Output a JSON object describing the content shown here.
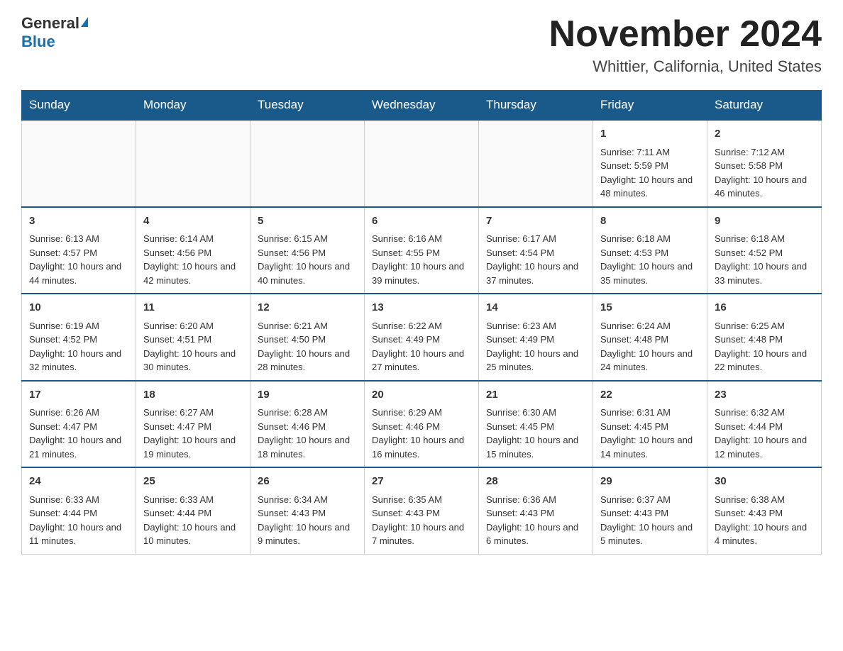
{
  "header": {
    "logo_general": "General",
    "logo_blue": "Blue",
    "title": "November 2024",
    "subtitle": "Whittier, California, United States"
  },
  "weekdays": [
    "Sunday",
    "Monday",
    "Tuesday",
    "Wednesday",
    "Thursday",
    "Friday",
    "Saturday"
  ],
  "weeks": [
    [
      {
        "day": "",
        "info": ""
      },
      {
        "day": "",
        "info": ""
      },
      {
        "day": "",
        "info": ""
      },
      {
        "day": "",
        "info": ""
      },
      {
        "day": "",
        "info": ""
      },
      {
        "day": "1",
        "info": "Sunrise: 7:11 AM\nSunset: 5:59 PM\nDaylight: 10 hours and 48 minutes."
      },
      {
        "day": "2",
        "info": "Sunrise: 7:12 AM\nSunset: 5:58 PM\nDaylight: 10 hours and 46 minutes."
      }
    ],
    [
      {
        "day": "3",
        "info": "Sunrise: 6:13 AM\nSunset: 4:57 PM\nDaylight: 10 hours and 44 minutes."
      },
      {
        "day": "4",
        "info": "Sunrise: 6:14 AM\nSunset: 4:56 PM\nDaylight: 10 hours and 42 minutes."
      },
      {
        "day": "5",
        "info": "Sunrise: 6:15 AM\nSunset: 4:56 PM\nDaylight: 10 hours and 40 minutes."
      },
      {
        "day": "6",
        "info": "Sunrise: 6:16 AM\nSunset: 4:55 PM\nDaylight: 10 hours and 39 minutes."
      },
      {
        "day": "7",
        "info": "Sunrise: 6:17 AM\nSunset: 4:54 PM\nDaylight: 10 hours and 37 minutes."
      },
      {
        "day": "8",
        "info": "Sunrise: 6:18 AM\nSunset: 4:53 PM\nDaylight: 10 hours and 35 minutes."
      },
      {
        "day": "9",
        "info": "Sunrise: 6:18 AM\nSunset: 4:52 PM\nDaylight: 10 hours and 33 minutes."
      }
    ],
    [
      {
        "day": "10",
        "info": "Sunrise: 6:19 AM\nSunset: 4:52 PM\nDaylight: 10 hours and 32 minutes."
      },
      {
        "day": "11",
        "info": "Sunrise: 6:20 AM\nSunset: 4:51 PM\nDaylight: 10 hours and 30 minutes."
      },
      {
        "day": "12",
        "info": "Sunrise: 6:21 AM\nSunset: 4:50 PM\nDaylight: 10 hours and 28 minutes."
      },
      {
        "day": "13",
        "info": "Sunrise: 6:22 AM\nSunset: 4:49 PM\nDaylight: 10 hours and 27 minutes."
      },
      {
        "day": "14",
        "info": "Sunrise: 6:23 AM\nSunset: 4:49 PM\nDaylight: 10 hours and 25 minutes."
      },
      {
        "day": "15",
        "info": "Sunrise: 6:24 AM\nSunset: 4:48 PM\nDaylight: 10 hours and 24 minutes."
      },
      {
        "day": "16",
        "info": "Sunrise: 6:25 AM\nSunset: 4:48 PM\nDaylight: 10 hours and 22 minutes."
      }
    ],
    [
      {
        "day": "17",
        "info": "Sunrise: 6:26 AM\nSunset: 4:47 PM\nDaylight: 10 hours and 21 minutes."
      },
      {
        "day": "18",
        "info": "Sunrise: 6:27 AM\nSunset: 4:47 PM\nDaylight: 10 hours and 19 minutes."
      },
      {
        "day": "19",
        "info": "Sunrise: 6:28 AM\nSunset: 4:46 PM\nDaylight: 10 hours and 18 minutes."
      },
      {
        "day": "20",
        "info": "Sunrise: 6:29 AM\nSunset: 4:46 PM\nDaylight: 10 hours and 16 minutes."
      },
      {
        "day": "21",
        "info": "Sunrise: 6:30 AM\nSunset: 4:45 PM\nDaylight: 10 hours and 15 minutes."
      },
      {
        "day": "22",
        "info": "Sunrise: 6:31 AM\nSunset: 4:45 PM\nDaylight: 10 hours and 14 minutes."
      },
      {
        "day": "23",
        "info": "Sunrise: 6:32 AM\nSunset: 4:44 PM\nDaylight: 10 hours and 12 minutes."
      }
    ],
    [
      {
        "day": "24",
        "info": "Sunrise: 6:33 AM\nSunset: 4:44 PM\nDaylight: 10 hours and 11 minutes."
      },
      {
        "day": "25",
        "info": "Sunrise: 6:33 AM\nSunset: 4:44 PM\nDaylight: 10 hours and 10 minutes."
      },
      {
        "day": "26",
        "info": "Sunrise: 6:34 AM\nSunset: 4:43 PM\nDaylight: 10 hours and 9 minutes."
      },
      {
        "day": "27",
        "info": "Sunrise: 6:35 AM\nSunset: 4:43 PM\nDaylight: 10 hours and 7 minutes."
      },
      {
        "day": "28",
        "info": "Sunrise: 6:36 AM\nSunset: 4:43 PM\nDaylight: 10 hours and 6 minutes."
      },
      {
        "day": "29",
        "info": "Sunrise: 6:37 AM\nSunset: 4:43 PM\nDaylight: 10 hours and 5 minutes."
      },
      {
        "day": "30",
        "info": "Sunrise: 6:38 AM\nSunset: 4:43 PM\nDaylight: 10 hours and 4 minutes."
      }
    ]
  ]
}
